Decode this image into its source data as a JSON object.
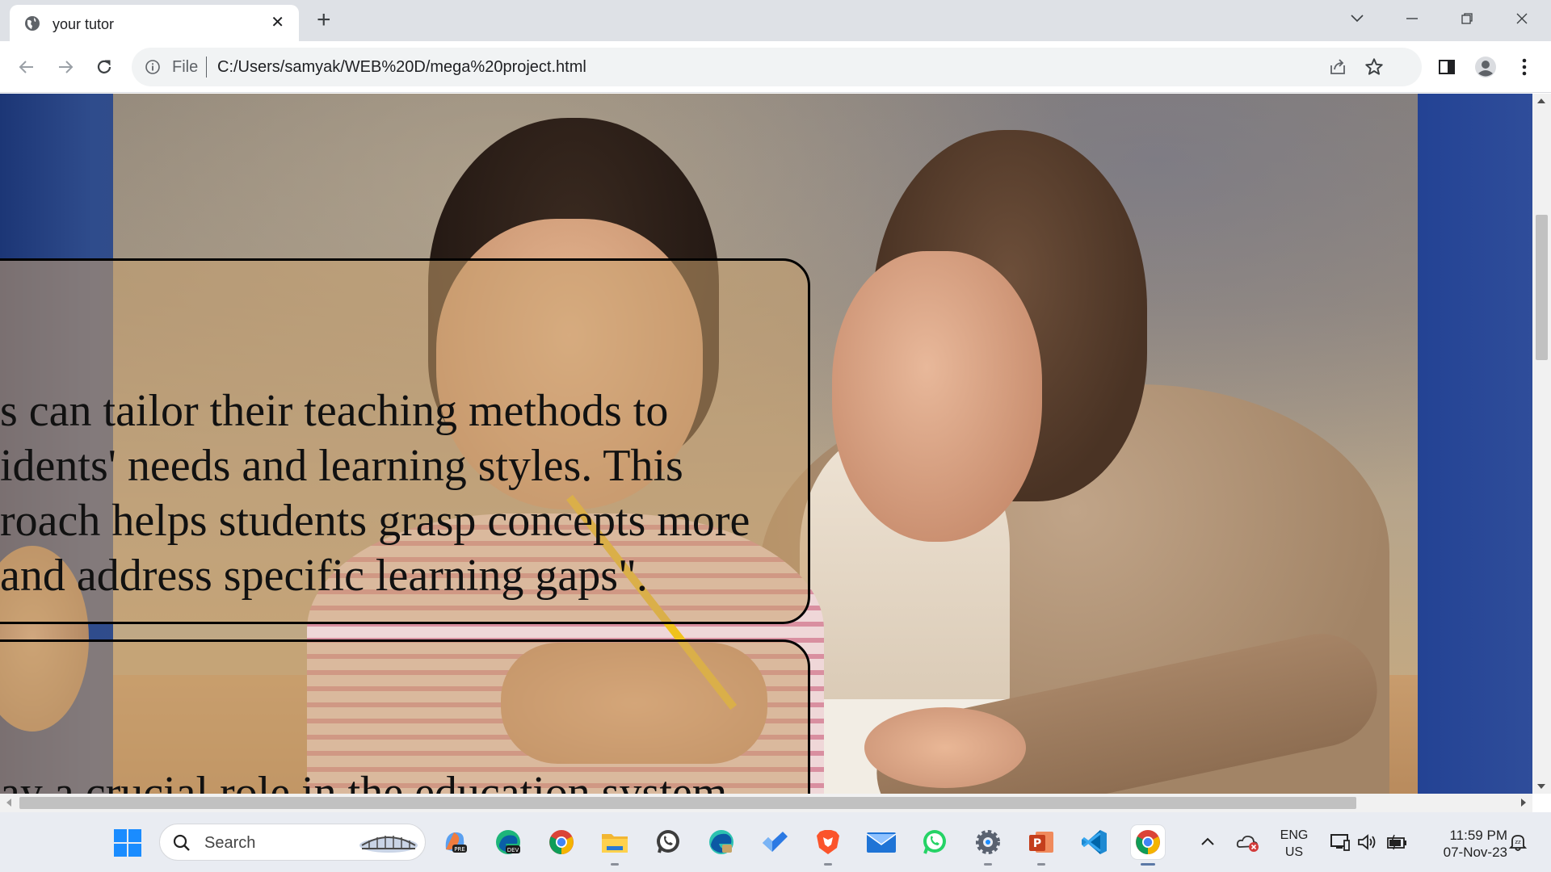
{
  "browser": {
    "tab_title": "your tutor",
    "tab_close": "✕",
    "new_tab": "+",
    "omnibox": {
      "scheme": "File",
      "url": "C:/Users/samyak/WEB%20D/mega%20project.html"
    }
  },
  "page": {
    "card1_lines": [
      "s can tailor their teaching methods to",
      "idents' needs and learning styles. This",
      "roach helps students grasp concepts more",
      "and address specific learning gaps\"."
    ],
    "card2_line": "ay a crucial role in the education system"
  },
  "taskbar": {
    "search_label": "Search",
    "apps": [
      "copilot-preview",
      "edge-dev",
      "chrome",
      "file-explorer",
      "whatsapp",
      "edge",
      "todo",
      "brave",
      "mail",
      "whatsapp-web",
      "settings",
      "powerpoint",
      "vscode",
      "chrome-active"
    ],
    "lang_top": "ENG",
    "lang_bottom": "US",
    "time": "11:59 PM",
    "date": "07-Nov-23"
  },
  "colors": {
    "tabstrip": "#dee1e6",
    "omnibox": "#f1f3f4",
    "taskbar": "#e9ecf2",
    "card_border": "#000000"
  }
}
